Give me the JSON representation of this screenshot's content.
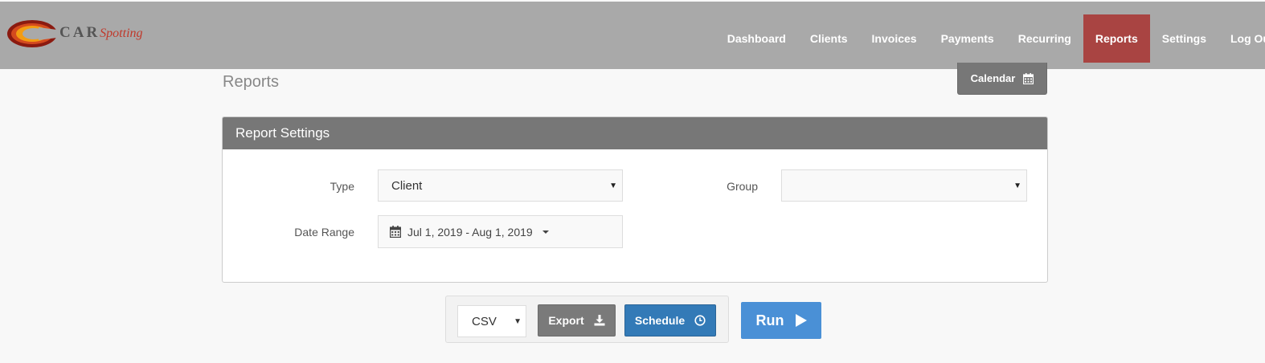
{
  "app": {
    "logo_text_car": "CAR",
    "logo_text_spotting": "Spotting"
  },
  "nav": {
    "items": [
      {
        "label": "Dashboard"
      },
      {
        "label": "Clients"
      },
      {
        "label": "Invoices"
      },
      {
        "label": "Payments"
      },
      {
        "label": "Recurring"
      },
      {
        "label": "Reports",
        "active": true
      },
      {
        "label": "Settings"
      },
      {
        "label": "Log Out"
      }
    ]
  },
  "page": {
    "title": "Reports",
    "calendar_label": "Calendar"
  },
  "settings": {
    "heading": "Report Settings",
    "type_label": "Type",
    "type_value": "Client",
    "group_label": "Group",
    "group_value": "",
    "date_range_label": "Date Range",
    "date_range_value": "Jul 1, 2019 - Aug 1, 2019"
  },
  "actions": {
    "format_value": "CSV",
    "export_label": "Export",
    "schedule_label": "Schedule",
    "run_label": "Run"
  },
  "icons": {
    "calendar": "calendar-icon",
    "download": "download-icon",
    "clock": "clock-icon",
    "play": "play-icon"
  },
  "colors": {
    "topbar": "#a9a9a9",
    "active_nav": "#a94442",
    "panel_header": "#777777",
    "schedule": "#337ab7",
    "run": "#4a90d6"
  }
}
